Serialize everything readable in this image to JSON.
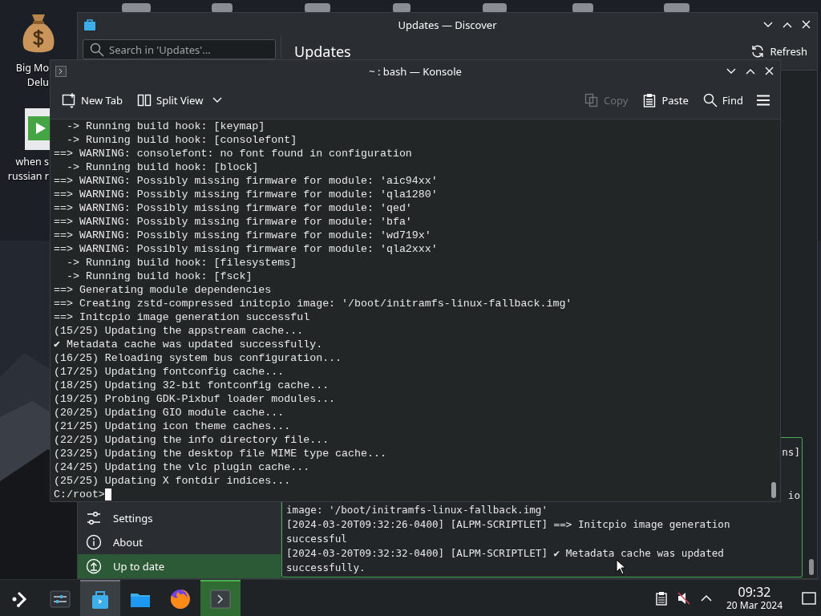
{
  "desktop": {
    "icons": [
      {
        "kind": "money-bag",
        "label_lines": [
          "Big Mo",
          "Delu"
        ]
      },
      {
        "kind": "video",
        "label_lines": [
          "when s",
          "russian r"
        ]
      }
    ]
  },
  "discover": {
    "title": "Updates — Discover",
    "search": {
      "placeholder": "Search in 'Updates'..."
    },
    "heading": "Updates",
    "refresh": "Refresh",
    "sidebar": {
      "items": [
        {
          "label": "Settings",
          "kind": "settings",
          "selected": false
        },
        {
          "label": "About",
          "kind": "about",
          "selected": false
        },
        {
          "label": "Up to date",
          "kind": "update",
          "selected": true
        }
      ]
    },
    "log": {
      "fragments": [
        "ns]",
        "io"
      ],
      "lines": [
        "image: '/boot/initramfs-linux-fallback.img'",
        "[2024-03-20T09:32:26-0400] [ALPM-SCRIPTLET] ==> Initcpio image generation",
        "successful",
        "[2024-03-20T09:32:32-0400] [ALPM-SCRIPTLET] ✔ Metadata cache was updated",
        "successfully."
      ]
    }
  },
  "konsole": {
    "title": "~ : bash — Konsole",
    "toolbar": [
      {
        "label": "New Tab",
        "kind": "new-tab",
        "disabled": false
      },
      {
        "label": "Split View",
        "kind": "split",
        "disabled": false
      },
      {
        "label": "Copy",
        "kind": "copy",
        "disabled": true
      },
      {
        "label": "Paste",
        "kind": "paste",
        "disabled": false
      },
      {
        "label": "Find",
        "kind": "search",
        "disabled": false
      }
    ],
    "lines": [
      "  -> Running build hook: [keymap]",
      "  -> Running build hook: [consolefont]",
      "==> WARNING: consolefont: no font found in configuration",
      "  -> Running build hook: [block]",
      "==> WARNING: Possibly missing firmware for module: 'aic94xx'",
      "==> WARNING: Possibly missing firmware for module: 'qla1280'",
      "==> WARNING: Possibly missing firmware for module: 'qed'",
      "==> WARNING: Possibly missing firmware for module: 'bfa'",
      "==> WARNING: Possibly missing firmware for module: 'wd719x'",
      "==> WARNING: Possibly missing firmware for module: 'qla2xxx'",
      "  -> Running build hook: [filesystems]",
      "  -> Running build hook: [fsck]",
      "==> Generating module dependencies",
      "==> Creating zstd-compressed initcpio image: '/boot/initramfs-linux-fallback.img'",
      "==> Initcpio image generation successful",
      "(15/25) Updating the appstream cache...",
      "✔ Metadata cache was updated successfully.",
      "(16/25) Reloading system bus configuration...",
      "(17/25) Updating fontconfig cache...",
      "(18/25) Updating 32-bit fontconfig cache...",
      "(19/25) Probing GDK-Pixbuf loader modules...",
      "(20/25) Updating GIO module cache...",
      "(21/25) Updating icon theme caches...",
      "(22/25) Updating the info directory file...",
      "(23/25) Updating the desktop file MIME type cache...",
      "(24/25) Updating the vlc plugin cache...",
      "(25/25) Updating X fontdir indices..."
    ],
    "prompt": "C:/root>"
  },
  "taskbar": {
    "apps": [
      {
        "kind": "launcher",
        "open": false,
        "focused": false
      },
      {
        "kind": "settings",
        "open": false,
        "focused": false
      },
      {
        "kind": "discover",
        "open": true,
        "focused": false
      },
      {
        "kind": "files",
        "open": false,
        "focused": false
      },
      {
        "kind": "firefox",
        "open": false,
        "focused": false
      },
      {
        "kind": "konsole",
        "open": true,
        "focused": true
      }
    ],
    "tray": [
      {
        "kind": "clipboard"
      },
      {
        "kind": "muted"
      },
      {
        "kind": "expand"
      }
    ],
    "clock": {
      "time": "09:32",
      "date": "20 Mar 2024"
    }
  }
}
